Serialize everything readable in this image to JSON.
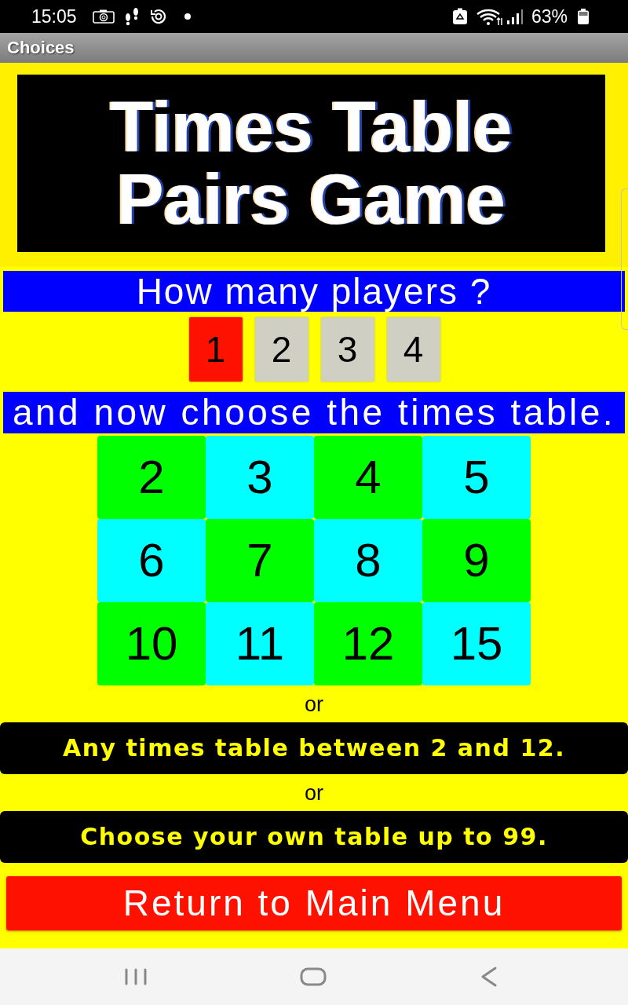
{
  "status_bar": {
    "time": "15:05",
    "battery": "63%"
  },
  "app_bar": {
    "title": "Choices"
  },
  "banner": {
    "title_lines": [
      "Times Table",
      "Pairs Game"
    ]
  },
  "players": {
    "prompt": "How many players ?",
    "options": [
      {
        "label": "1",
        "selected": true
      },
      {
        "label": "2",
        "selected": false
      },
      {
        "label": "3",
        "selected": false
      },
      {
        "label": "4",
        "selected": false
      }
    ]
  },
  "tables": {
    "prompt": "and now choose the times table.",
    "options": [
      {
        "label": "2",
        "color": "#00ff00"
      },
      {
        "label": "3",
        "color": "#00ffff"
      },
      {
        "label": "4",
        "color": "#00ff00"
      },
      {
        "label": "5",
        "color": "#00ffff"
      },
      {
        "label": "6",
        "color": "#00ffff"
      },
      {
        "label": "7",
        "color": "#00ff00"
      },
      {
        "label": "8",
        "color": "#00ffff"
      },
      {
        "label": "9",
        "color": "#00ff00"
      },
      {
        "label": "10",
        "color": "#00ff00"
      },
      {
        "label": "11",
        "color": "#00ffff"
      },
      {
        "label": "12",
        "color": "#00ff00"
      },
      {
        "label": "15",
        "color": "#00ffff"
      }
    ]
  },
  "alternatives": [
    {
      "separator": "or",
      "label": "Any times table between 2 and 12."
    },
    {
      "separator": "or",
      "label": "Choose your own table up to 99."
    }
  ],
  "return_button": {
    "label": "Return to Main Menu"
  }
}
